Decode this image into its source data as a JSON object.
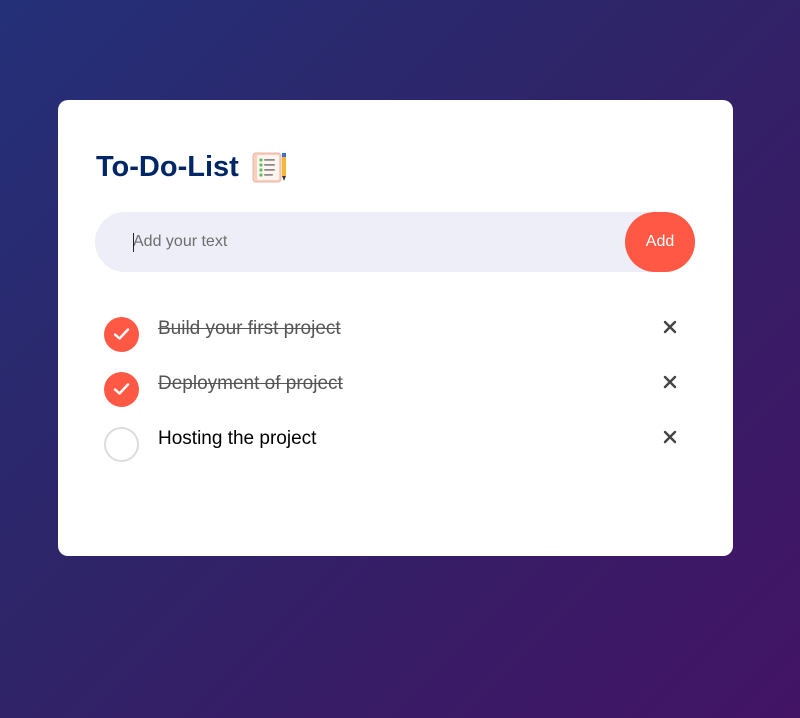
{
  "app": {
    "title": "To-Do-List",
    "title_icon": "notepad-icon"
  },
  "input": {
    "value": "",
    "placeholder": "Add your text",
    "add_label": "Add"
  },
  "todos": [
    {
      "text": "Build your first project",
      "done": true,
      "delete_icon": "close-icon"
    },
    {
      "text": "Deployment of project",
      "done": true,
      "delete_icon": "close-icon"
    },
    {
      "text": "Hosting the project",
      "done": false,
      "delete_icon": "close-icon"
    }
  ],
  "colors": {
    "accent": "#ff5945",
    "title": "#002765",
    "input_bg": "#edeef7",
    "bg_start": "#243078",
    "bg_end": "#431466"
  }
}
